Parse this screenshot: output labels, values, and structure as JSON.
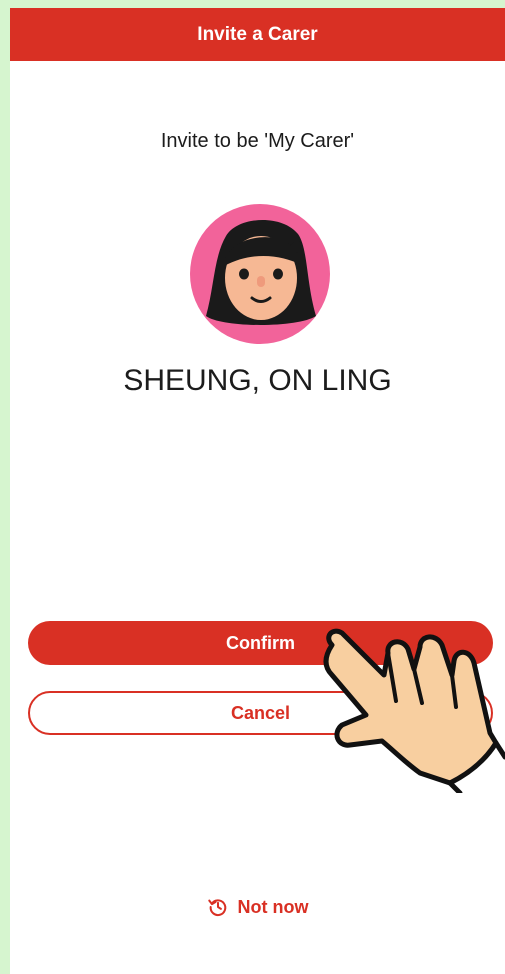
{
  "header": {
    "title": "Invite a Carer"
  },
  "subtitle": "Invite to be 'My Carer'",
  "carer": {
    "name": "SHEUNG, ON LING",
    "avatar_icon": "female-avatar-icon"
  },
  "actions": {
    "confirm_label": "Confirm",
    "cancel_label": "Cancel",
    "not_now_label": "Not now",
    "not_now_icon": "history-icon"
  },
  "overlay": {
    "icon": "pointing-hand-icon"
  },
  "colors": {
    "accent": "#d93024",
    "background_frame": "#d6f5cf",
    "avatar_bg": "#f2639a"
  }
}
